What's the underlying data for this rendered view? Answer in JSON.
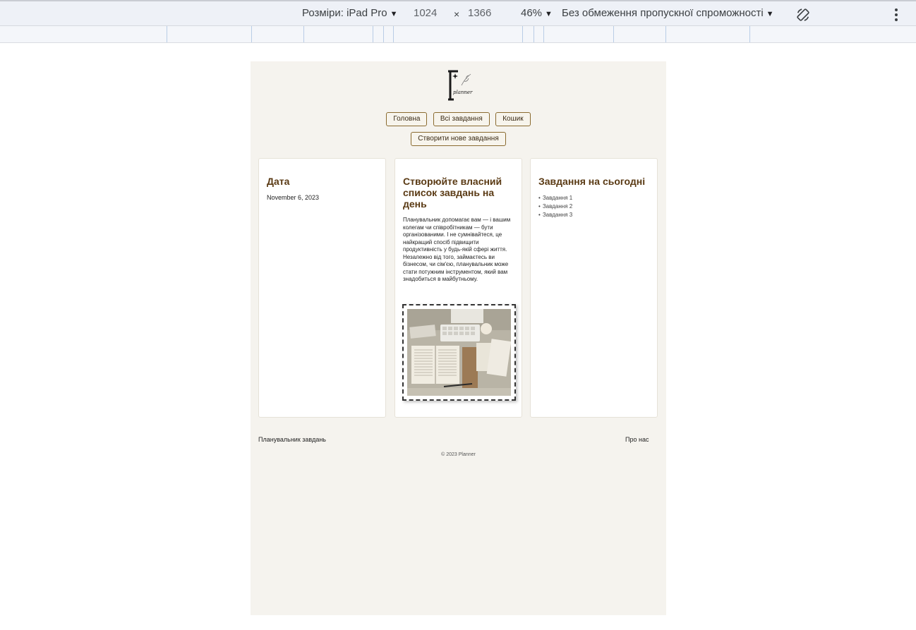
{
  "devtools": {
    "dimensions_label": "Розміри: iPad Pro",
    "width": "1024",
    "times": "×",
    "height": "1366",
    "zoom": "46%",
    "throttling": "Без обмеження пропускної спроможності",
    "icons": [
      "rotate-icon",
      "more-vert-icon",
      "chevron-down-icon"
    ]
  },
  "page": {
    "nav": {
      "home": "Головна",
      "all_tasks": "Всі завдання",
      "trash": "Кошик",
      "create": "Створити нове завдання"
    },
    "date_card": {
      "title": "Дата",
      "date": "November 6, 2023"
    },
    "intro_card": {
      "title": "Створюйте власний список завдань на день",
      "text": "Планувальник допомагає вам — і вашим колегам чи співробітникам — бути організованими. І не сумнівайтеся, це найкращий спосіб підвищити продуктивність у будь-якій сфері життя. Незалежно від того, займаєтесь ви бізнесом, чи сім'єю, планувальник може стати потужним інструментом, який вам знадобиться в майбутньому."
    },
    "today_card": {
      "title": "Завдання на сьогодні",
      "tasks": [
        "Завдання 1",
        "Завдання 2",
        "Завдання 3"
      ]
    },
    "footer": {
      "left": "Планувальник завдань",
      "right": "Про нас",
      "copyright": "© 2023 Planner"
    },
    "colors": {
      "page_bg": "#f5f3ee",
      "accent": "#8a6a2f",
      "heading": "#5a3a14"
    }
  }
}
